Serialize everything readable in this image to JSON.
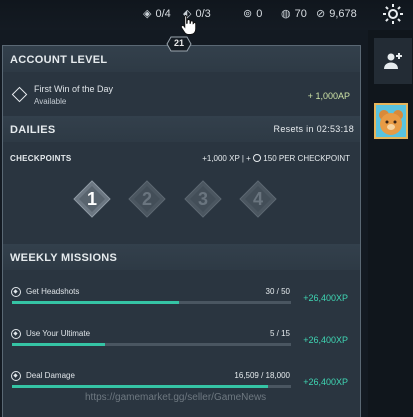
{
  "topbar": {
    "quest_count": "0/4",
    "second_count": "0/3",
    "kingdom_credits": "0",
    "radianite": "70",
    "vp": "9,678",
    "level_badge": "21"
  },
  "account_level": {
    "heading": "ACCOUNT LEVEL",
    "first_win_title": "First Win of the Day",
    "first_win_status": "Available",
    "first_win_reward": "+ 1,000AP"
  },
  "dailies": {
    "heading": "DAILIES",
    "resets": "Resets in 02:53:18",
    "checkpoints_label": "CHECKPOINTS",
    "checkpoints_reward_a": "+1,000 XP | +",
    "checkpoints_reward_b": "150 PER CHECKPOINT",
    "checkpoints": [
      {
        "label": "1"
      },
      {
        "label": "2"
      },
      {
        "label": "3"
      },
      {
        "label": "4"
      }
    ]
  },
  "weekly": {
    "heading": "WEEKLY MISSIONS",
    "missions": [
      {
        "name": "Get Headshots",
        "progress": "30 / 50",
        "fraction": 0.6,
        "reward": "+26,400XP"
      },
      {
        "name": "Use Your Ultimate",
        "progress": "5 / 15",
        "fraction": 0.333,
        "reward": "+26,400XP"
      },
      {
        "name": "Deal Damage",
        "progress": "16,509 / 18,000",
        "fraction": 0.917,
        "reward": "+26,400XP"
      }
    ]
  },
  "watermark": "https://gamemarket.gg/seller/GameNews",
  "colors": {
    "accent_teal": "#35c4a5",
    "reward_green": "#3fd6b3",
    "panel": "#2a3540"
  }
}
